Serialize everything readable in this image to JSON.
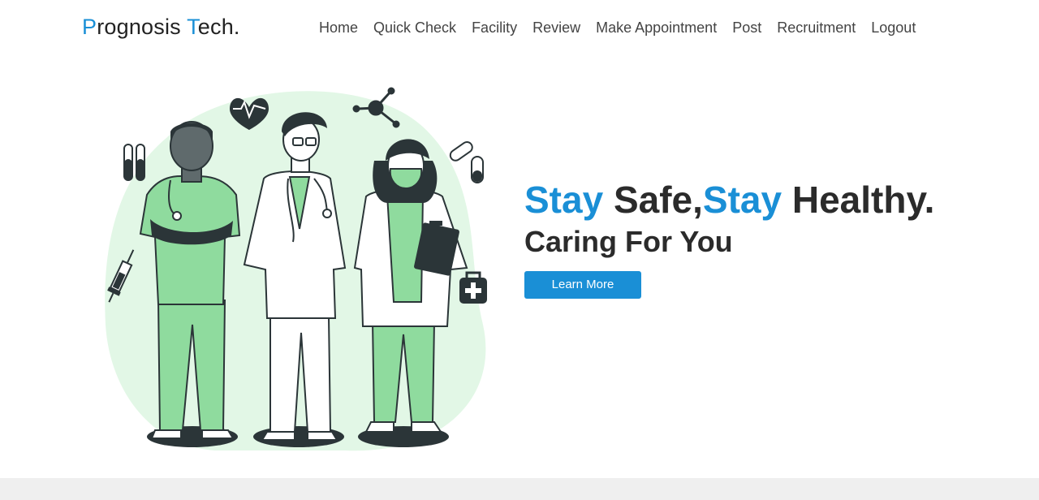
{
  "brand": {
    "p1": "P",
    "p2": "rognosis ",
    "p3": "T",
    "p4": "ech."
  },
  "nav": [
    {
      "label": "Home"
    },
    {
      "label": "Quick Check"
    },
    {
      "label": "Facility"
    },
    {
      "label": "Review"
    },
    {
      "label": "Make Appointment"
    },
    {
      "label": "Post"
    },
    {
      "label": "Recruitment"
    },
    {
      "label": "Logout"
    }
  ],
  "hero": {
    "headline_a": "Stay",
    "headline_b": " Safe,",
    "headline_c": "Stay",
    "headline_d": " Healthy.",
    "subheadline": "Caring For You",
    "cta": "Learn More"
  },
  "colors": {
    "accent": "#1a8fd6",
    "scrub": "#8fdb9e",
    "blob": "#e2f7e6",
    "dark": "#2b3538"
  }
}
